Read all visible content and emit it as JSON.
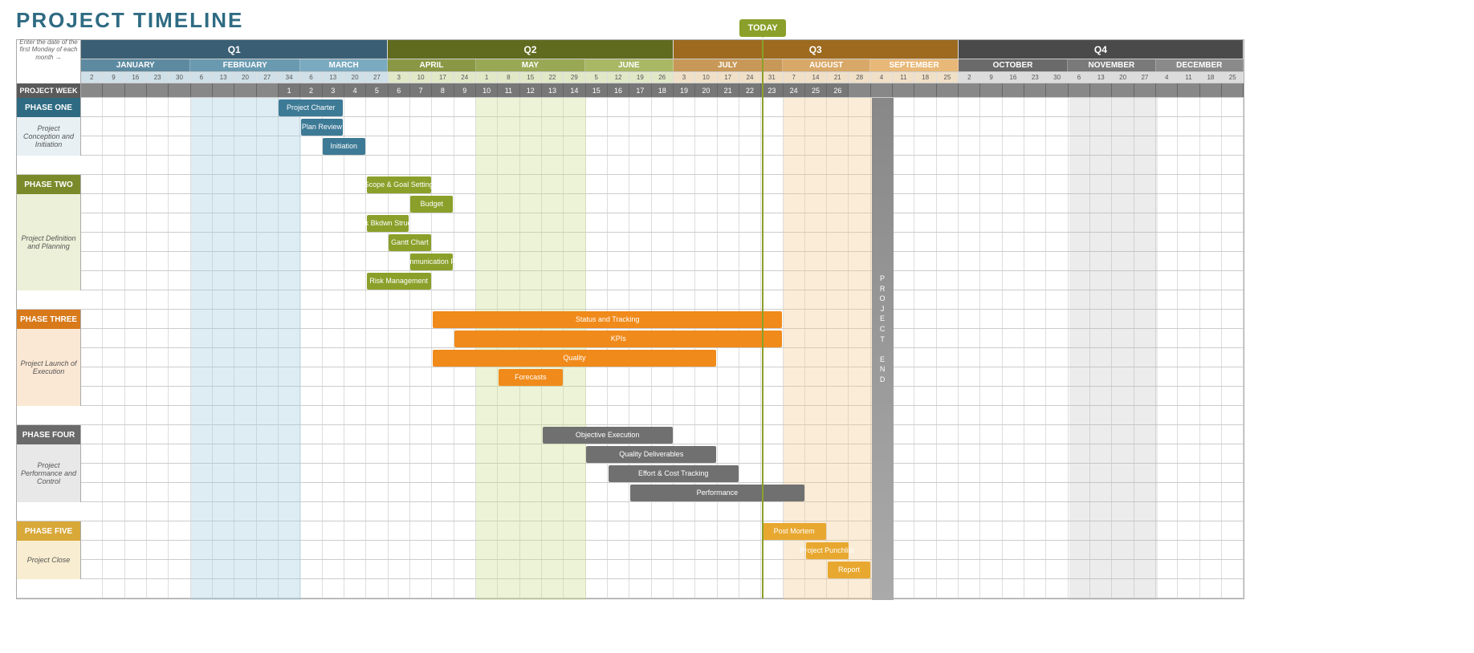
{
  "title": "PROJECT TIMELINE",
  "hint": "Enter the date of the first Monday of each month →",
  "today": "TODAY",
  "project_week_label": "PROJECT WEEK",
  "project_end_label": "P R O J E C T   E N D",
  "quarters": [
    {
      "label": "Q1",
      "class": "q1",
      "months": [
        "JANUARY",
        "FEBRUARY",
        "MARCH"
      ]
    },
    {
      "label": "Q2",
      "class": "q2",
      "months": [
        "APRIL",
        "MAY",
        "JUNE"
      ]
    },
    {
      "label": "Q3",
      "class": "q3",
      "months": [
        "JULY",
        "AUGUST",
        "SEPTEMBER"
      ]
    },
    {
      "label": "Q4",
      "class": "q4",
      "months": [
        "OCTOBER",
        "NOVEMBER",
        "DECEMBER"
      ]
    }
  ],
  "month_classes": [
    "m-jan",
    "m-feb",
    "m-mar",
    "m-apr",
    "m-may",
    "m-jun",
    "m-jul",
    "m-aug",
    "m-sep",
    "m-oct",
    "m-nov",
    "m-dec"
  ],
  "day_labels": [
    [
      "2",
      "9",
      "16",
      "23",
      "30"
    ],
    [
      "6",
      "13",
      "20",
      "27",
      "34"
    ],
    [
      "6",
      "13",
      "20",
      "27"
    ],
    [
      "3",
      "10",
      "17",
      "24"
    ],
    [
      "1",
      "8",
      "15",
      "22",
      "29"
    ],
    [
      "5",
      "12",
      "19",
      "26"
    ],
    [
      "3",
      "10",
      "17",
      "24",
      "31"
    ],
    [
      "7",
      "14",
      "21",
      "28"
    ],
    [
      "4",
      "11",
      "18",
      "25"
    ],
    [
      "2",
      "9",
      "16",
      "23",
      "30"
    ],
    [
      "6",
      "13",
      "20",
      "27"
    ],
    [
      "4",
      "11",
      "18",
      "25"
    ]
  ],
  "weeks_nonempty_start": 9,
  "weeks_nonempty_labels": [
    "1",
    "2",
    "3",
    "4",
    "5",
    "6",
    "7",
    "8",
    "9",
    "10",
    "11",
    "12",
    "13",
    "14",
    "15",
    "16",
    "17",
    "18",
    "19",
    "20",
    "21",
    "22",
    "23",
    "24",
    "25",
    "26"
  ],
  "phases": [
    {
      "id": "ph1",
      "name": "PHASE ONE",
      "desc": "Project Conception and Initiation",
      "rows": 3,
      "color": "c-blue"
    },
    {
      "id": "ph2",
      "name": "PHASE TWO",
      "desc": "Project Definition and Planning",
      "rows": 6,
      "color": "c-green"
    },
    {
      "id": "ph3",
      "name": "PHASE THREE",
      "desc": "Project Launch of Execution",
      "rows": 5,
      "color": "c-orange"
    },
    {
      "id": "ph4",
      "name": "PHASE FOUR",
      "desc": "Project Performance and Control",
      "rows": 4,
      "color": "c-grey"
    },
    {
      "id": "ph5",
      "name": "PHASE FIVE",
      "desc": "Project Close",
      "rows": 3,
      "color": "c-gold"
    }
  ],
  "chart_data": {
    "type": "gantt",
    "unit": "week-column (0-based, 0 = first Monday of January)",
    "today_col": 31,
    "project_end_col": 36,
    "shaded_months": [
      "FEBRUARY",
      "MAY",
      "AUGUST",
      "NOVEMBER"
    ],
    "tasks": [
      {
        "phase": 0,
        "row": 0,
        "label": "Project Charter",
        "start": 9,
        "dur": 3,
        "color": "c-blue"
      },
      {
        "phase": 0,
        "row": 1,
        "label": "Plan Review",
        "start": 10,
        "dur": 2,
        "color": "c-blue"
      },
      {
        "phase": 0,
        "row": 2,
        "label": "Initiation",
        "start": 11,
        "dur": 2,
        "color": "c-blue"
      },
      {
        "phase": 1,
        "row": 0,
        "label": "Scope & Goal Setting",
        "start": 13,
        "dur": 3,
        "color": "c-green"
      },
      {
        "phase": 1,
        "row": 1,
        "label": "Budget",
        "start": 15,
        "dur": 2,
        "color": "c-green"
      },
      {
        "phase": 1,
        "row": 2,
        "label": "Work Bkdwn Structure",
        "start": 13,
        "dur": 2,
        "color": "c-green"
      },
      {
        "phase": 1,
        "row": 3,
        "label": "Gantt Chart",
        "start": 14,
        "dur": 2,
        "color": "c-green"
      },
      {
        "phase": 1,
        "row": 4,
        "label": "Communication Plan",
        "start": 15,
        "dur": 2,
        "color": "c-green"
      },
      {
        "phase": 1,
        "row": 5,
        "label": "Risk Management",
        "start": 13,
        "dur": 3,
        "color": "c-green"
      },
      {
        "phase": 2,
        "row": 0,
        "label": "Status and Tracking",
        "start": 16,
        "dur": 16,
        "color": "c-orange"
      },
      {
        "phase": 2,
        "row": 1,
        "label": "KPIs",
        "start": 17,
        "dur": 15,
        "color": "c-orange"
      },
      {
        "phase": 2,
        "row": 2,
        "label": "Quality",
        "start": 16,
        "dur": 13,
        "color": "c-orange"
      },
      {
        "phase": 2,
        "row": 3,
        "label": "Forecasts",
        "start": 19,
        "dur": 3,
        "color": "c-orange"
      },
      {
        "phase": 3,
        "row": 0,
        "label": "Objective Execution",
        "start": 21,
        "dur": 6,
        "color": "c-grey"
      },
      {
        "phase": 3,
        "row": 1,
        "label": "Quality Deliverables",
        "start": 23,
        "dur": 6,
        "color": "c-grey"
      },
      {
        "phase": 3,
        "row": 2,
        "label": "Effort & Cost Tracking",
        "start": 24,
        "dur": 6,
        "color": "c-grey"
      },
      {
        "phase": 3,
        "row": 3,
        "label": "Performance",
        "start": 25,
        "dur": 8,
        "color": "c-grey"
      },
      {
        "phase": 4,
        "row": 0,
        "label": "Post Mortem",
        "start": 31,
        "dur": 3,
        "color": "c-gold"
      },
      {
        "phase": 4,
        "row": 1,
        "label": "Project Punchlist",
        "start": 33,
        "dur": 2,
        "color": "c-gold"
      },
      {
        "phase": 4,
        "row": 2,
        "label": "Report",
        "start": 34,
        "dur": 2,
        "color": "c-gold"
      }
    ]
  }
}
